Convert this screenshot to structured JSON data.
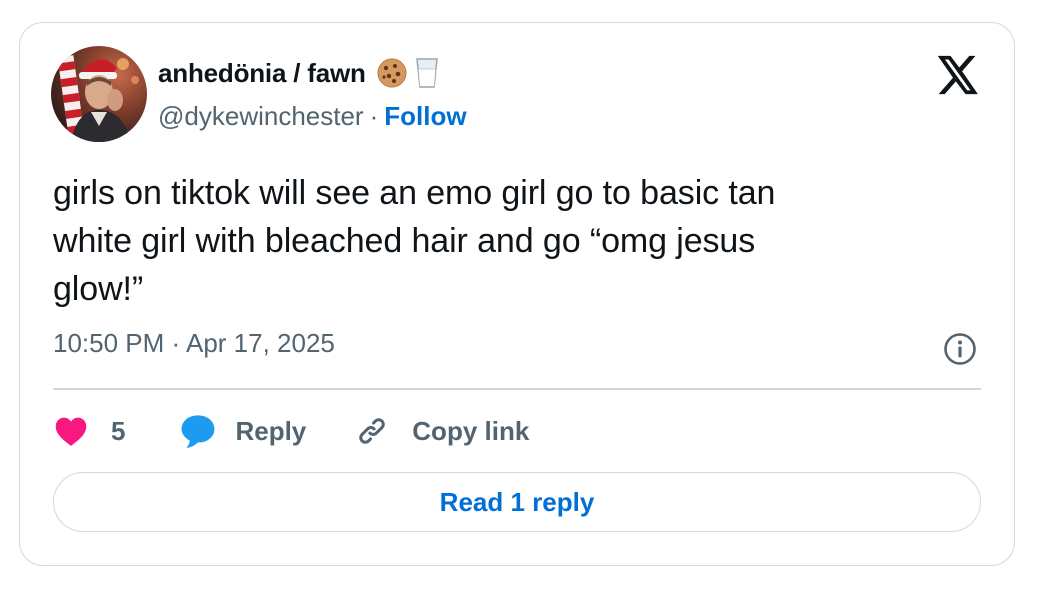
{
  "author": {
    "display_name": "anhedönia / fawn",
    "name_emojis": [
      "cookie-emoji",
      "milk-glass-emoji"
    ],
    "handle": "@dykewinchester",
    "separator": "·",
    "follow_label": "Follow",
    "avatar": "avatar-photo"
  },
  "brand": {
    "logo": "x-logo-icon"
  },
  "tweet": {
    "text_line1": "girls on tiktok will see an emo girl go to basic tan",
    "text_line2": "white girl with bleached hair and go “omg jesus",
    "text_line3": "glow!”",
    "time": "10:50 PM",
    "time_separator": "·",
    "date": "Apr 17, 2025"
  },
  "actions": {
    "like_count": "5",
    "reply_label": "Reply",
    "copy_link_label": "Copy link",
    "read_replies_label": "Read 1 reply"
  },
  "colors": {
    "text_primary": "#0f1419",
    "text_secondary": "#536471",
    "link_blue": "#006fd6",
    "like_pink": "#f91880",
    "reply_blue": "#1d9bf0",
    "border": "#cfd9de"
  }
}
